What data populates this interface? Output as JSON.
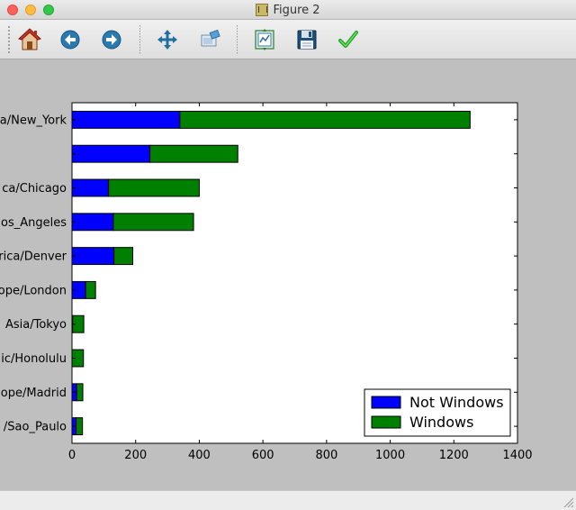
{
  "window": {
    "title": "Figure 2"
  },
  "toolbar": {
    "buttons": [
      {
        "name": "home-button",
        "icon": "home-icon"
      },
      {
        "name": "back-button",
        "icon": "back-arrow-icon"
      },
      {
        "name": "forward-button",
        "icon": "forward-arrow-icon"
      },
      {
        "name": "pan-button",
        "icon": "move-arrows-icon"
      },
      {
        "name": "zoom-button",
        "icon": "zoom-rect-icon"
      },
      {
        "name": "subplots-button",
        "icon": "subplots-icon"
      },
      {
        "name": "save-button",
        "icon": "floppy-disk-icon"
      },
      {
        "name": "edit-axis-button",
        "icon": "checkmark-icon"
      }
    ]
  },
  "colors": {
    "not_windows": "#0000ff",
    "windows": "#008000",
    "figure_bg": "#bfbfbf",
    "axes_bg": "#ffffff"
  },
  "chart_data": {
    "type": "bar",
    "orientation": "horizontal",
    "stacked": true,
    "categories": [
      "a/New_York",
      "",
      "ca/Chicago",
      "os_Angeles",
      "rica/Denver",
      "ope/London",
      "Asia/Tokyo",
      "ic/Honolulu",
      "ope/Madrid",
      "/Sao_Paulo"
    ],
    "series": [
      {
        "name": "Not Windows",
        "values": [
          339,
          245,
          115,
          130,
          132,
          43,
          2,
          0,
          15,
          13
        ]
      },
      {
        "name": "Windows",
        "values": [
          912,
          276,
          285,
          252,
          59,
          31,
          35,
          36,
          19,
          20
        ]
      }
    ],
    "xticks": [
      "0",
      "200",
      "400",
      "600",
      "800",
      "1000",
      "1200",
      "1400"
    ],
    "xlim": [
      0,
      1400
    ],
    "legend_position": "lower-right",
    "grid": false
  }
}
